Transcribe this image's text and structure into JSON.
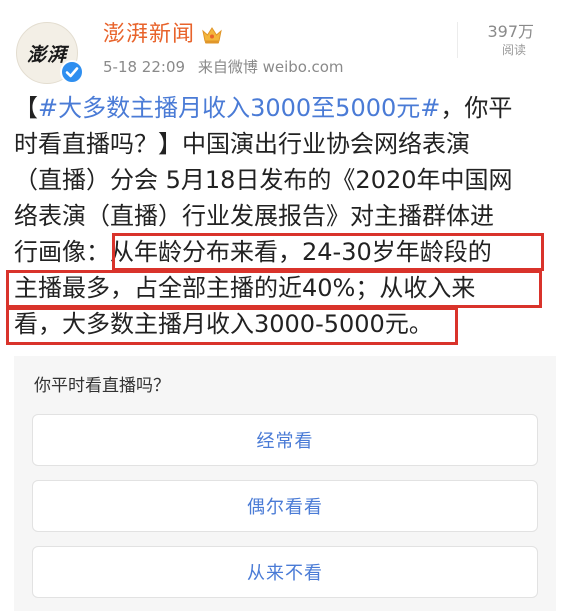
{
  "header": {
    "avatar_text": "澎湃",
    "account_name": "澎湃新闻",
    "timestamp": "5-18 22:09",
    "source": "来自微博 weibo.com",
    "views_count": "397万",
    "views_label": "阅读"
  },
  "post": {
    "lines": [
      {
        "parts": [
          {
            "text": "【",
            "type": "text"
          },
          {
            "text": "#大多数主播月收入3000至5000元#",
            "type": "hashtag"
          },
          {
            "text": "，你平",
            "type": "text"
          }
        ]
      },
      {
        "parts": [
          {
            "text": "时看直播吗？】中国演出行业协会网络表演",
            "type": "text"
          }
        ]
      },
      {
        "parts": [
          {
            "text": "（直播）分会 5月18日发布的《2020年中国网",
            "type": "text"
          }
        ]
      },
      {
        "parts": [
          {
            "text": "络表演（直播）行业发展报告》对主播群体进",
            "type": "text"
          }
        ]
      },
      {
        "parts": [
          {
            "text": "行画像：从年龄分布来看，24-30岁年龄段的",
            "type": "text"
          }
        ]
      },
      {
        "parts": [
          {
            "text": "主播最多，占全部主播的近40%；从收入来",
            "type": "text"
          }
        ]
      },
      {
        "parts": [
          {
            "text": "看，大多数主播月收入3000-5000元。",
            "type": "text"
          }
        ]
      }
    ]
  },
  "poll": {
    "question": "你平时看直播吗？",
    "options": [
      "经常看",
      "偶尔看看",
      "从来不看"
    ]
  },
  "colors": {
    "account_name": "#e8632b",
    "hashtag": "#4a7bd6",
    "highlight_border": "#d9332b",
    "poll_option_text": "#4a7bd6",
    "verified": "#2f8ff0"
  }
}
